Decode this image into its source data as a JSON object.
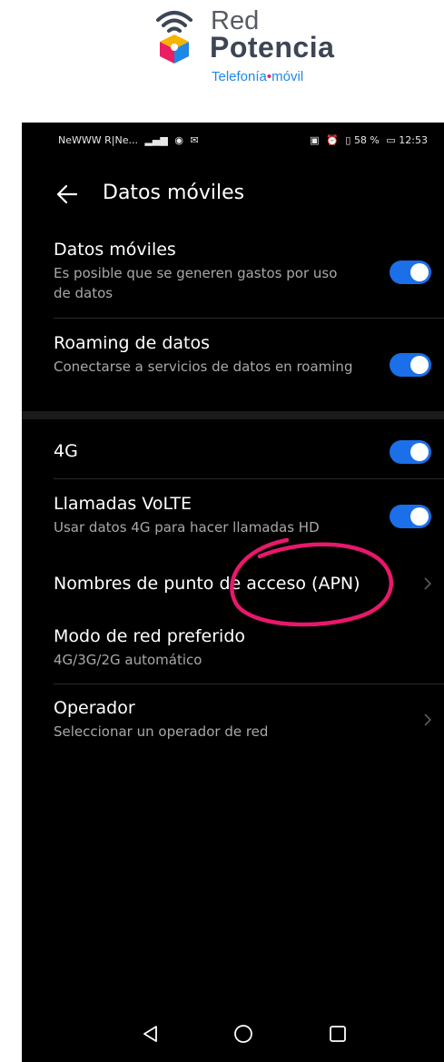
{
  "brand": {
    "name_line1": "Red",
    "name_line2": "Potencia",
    "tag_left": "Telefonía",
    "tag_dot": "•",
    "tag_right": "móvil",
    "colors": {
      "text": "#3c4654",
      "tag": "#1e88e5",
      "accent": "#e91e63"
    }
  },
  "status_bar": {
    "carrier": "NeWWW R|Ne...",
    "battery": "58 %",
    "time": "12:53"
  },
  "header": {
    "title": "Datos móviles"
  },
  "settings": {
    "mobile_data": {
      "title": "Datos móviles",
      "subtitle": "Es posible que se generen gastos por uso de datos",
      "enabled": true
    },
    "roaming": {
      "title": "Roaming de datos",
      "subtitle": "Conectarse a servicios de datos en roaming",
      "enabled": true
    },
    "lte": {
      "title": "4G",
      "enabled": true
    },
    "volte": {
      "title": "Llamadas VoLTE",
      "subtitle": "Usar datos 4G para hacer llamadas HD",
      "enabled": true
    },
    "apn": {
      "title": "Nombres de punto de acceso (APN)"
    },
    "network_mode": {
      "title": "Modo de red preferido",
      "subtitle": "4G/3G/2G automático"
    },
    "operator": {
      "title": "Operador",
      "subtitle": "Seleccionar un operador de red"
    }
  },
  "colors": {
    "toggle_on": "#1b6fe8",
    "highlight_circle": "#e8186b",
    "background": "#000000"
  }
}
